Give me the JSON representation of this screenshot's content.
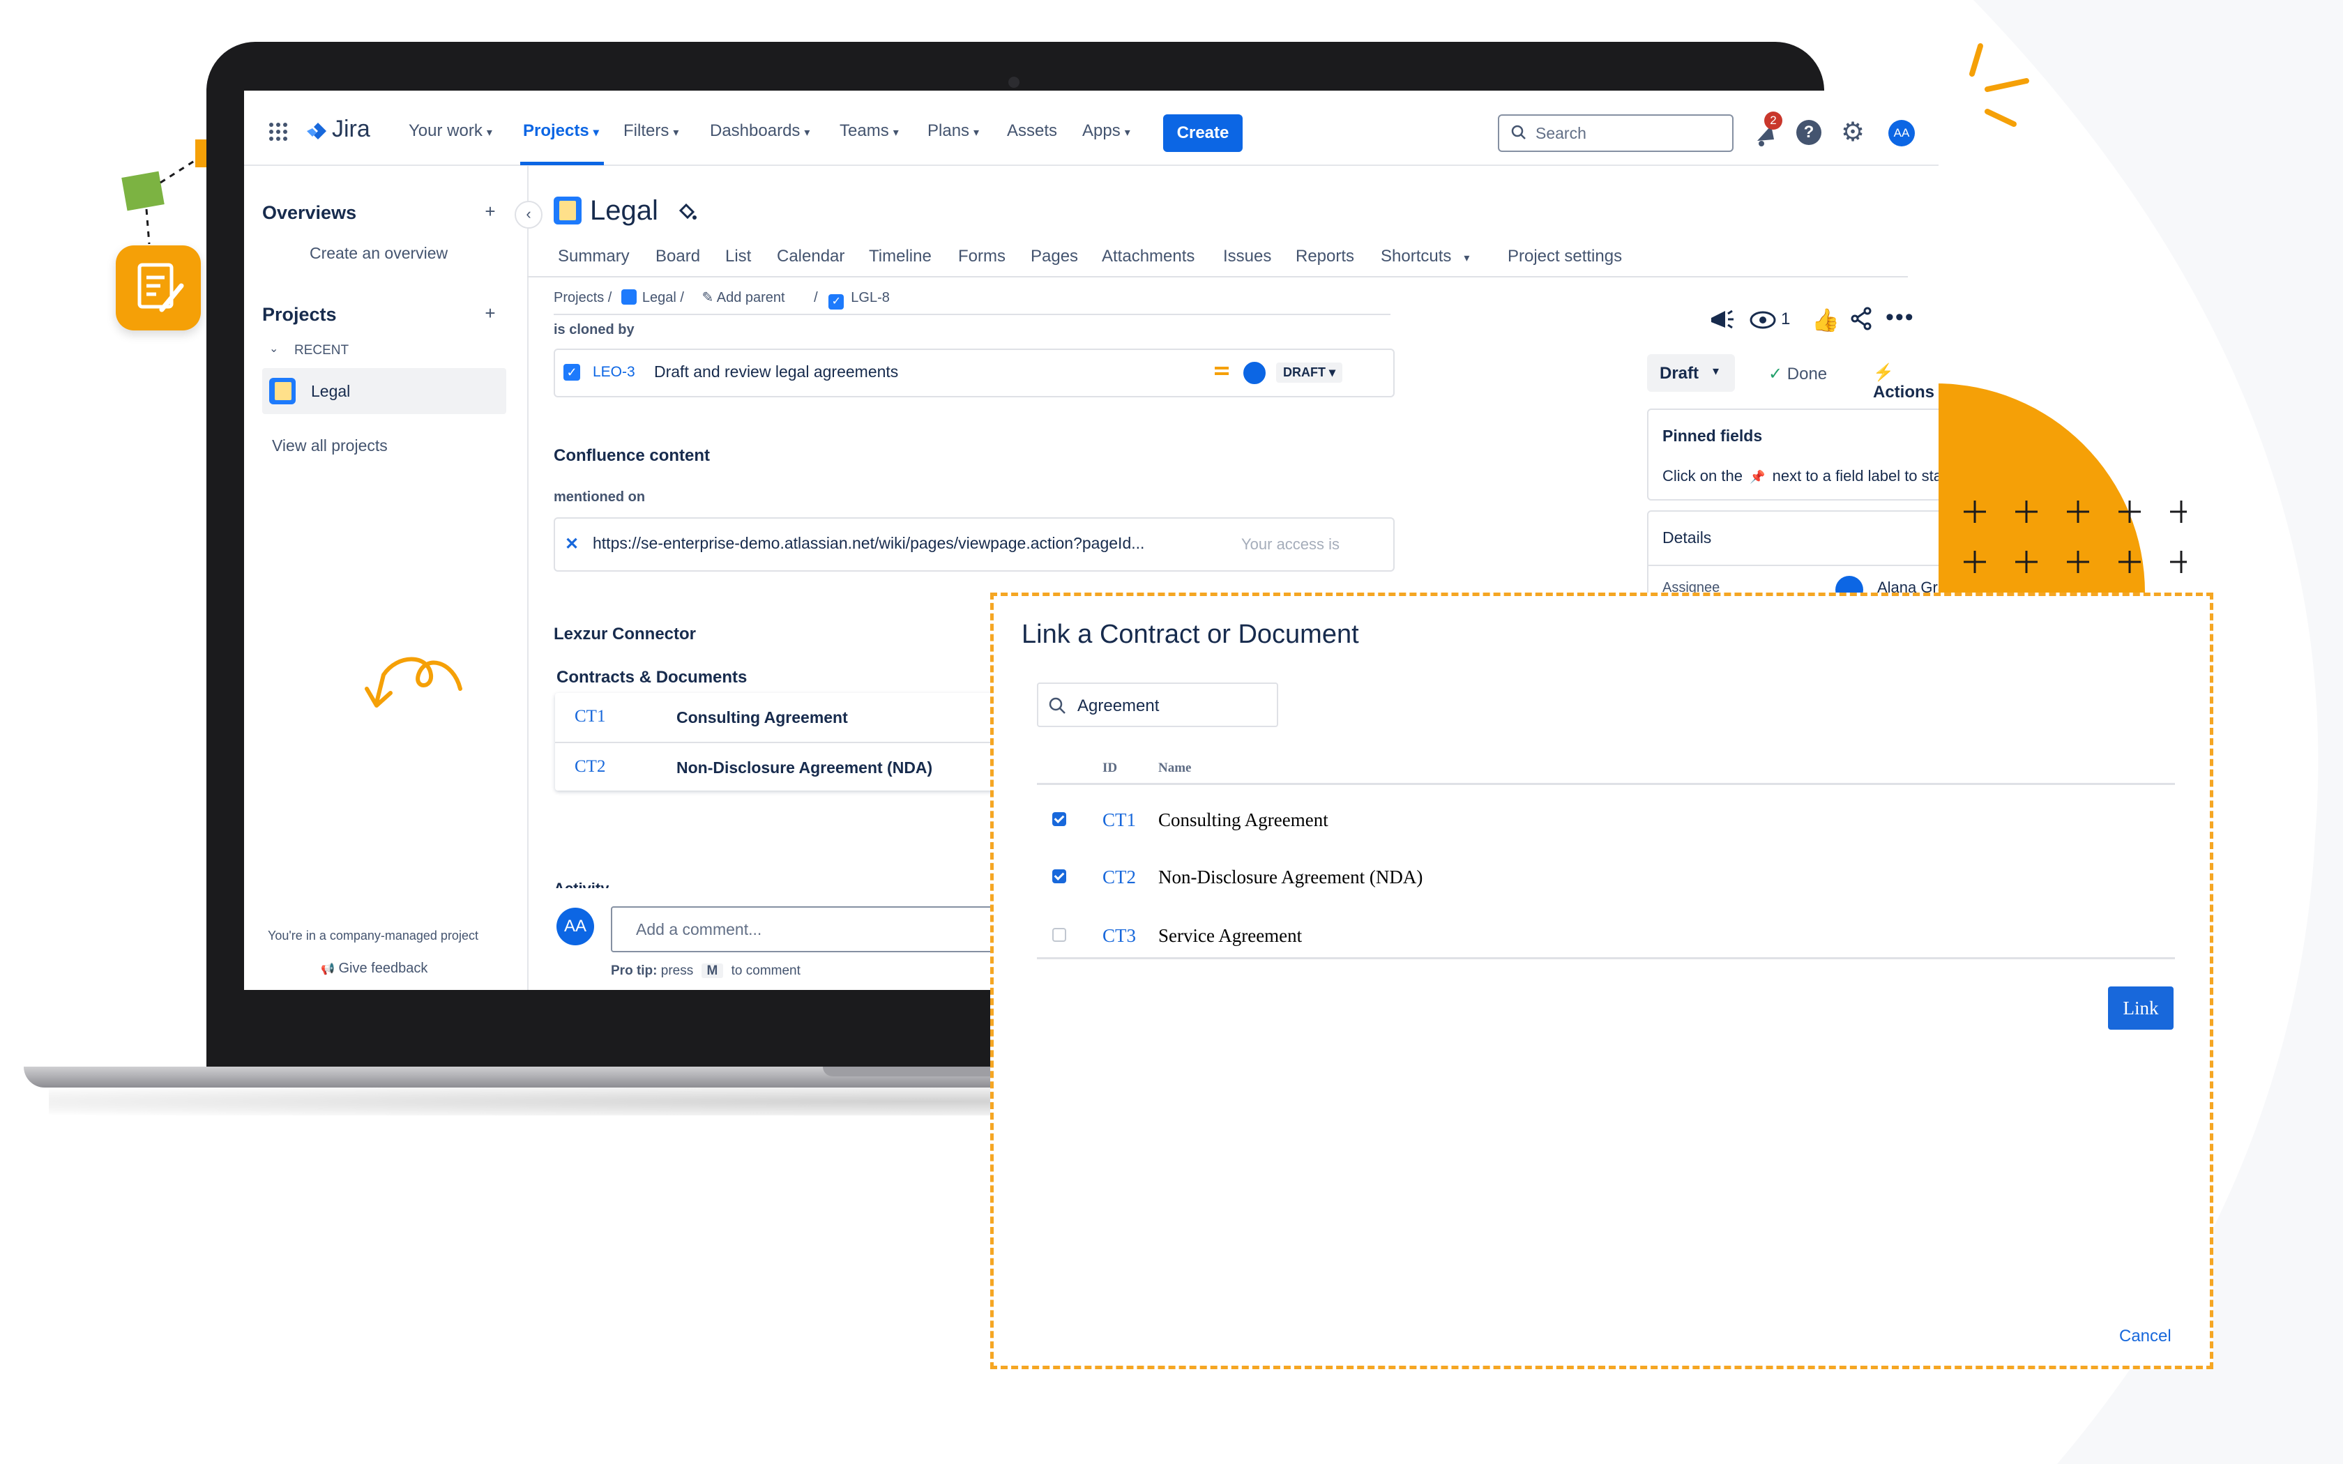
{
  "colors": {
    "accent": "#0c66e4",
    "orange": "#f5a623",
    "ink": "#172b4d",
    "subtle": "#44546f",
    "green_shape": "#7cb342"
  },
  "topnav": {
    "logo_text": "Jira",
    "items": [
      {
        "label": "Your work"
      },
      {
        "label": "Projects"
      },
      {
        "label": "Filters"
      },
      {
        "label": "Dashboards"
      },
      {
        "label": "Teams"
      },
      {
        "label": "Plans"
      },
      {
        "label": "Assets"
      },
      {
        "label": "Apps"
      }
    ],
    "create_label": "Create",
    "search_placeholder": "Search",
    "notification_count": "2",
    "avatar_initials": "AA"
  },
  "sidebar": {
    "overviews_title": "Overviews",
    "create_overview": "Create an overview",
    "projects_title": "Projects",
    "recent_label": "RECENT",
    "recent_project": "Legal",
    "view_all": "View all projects",
    "footer_note": "You're in a company-managed project",
    "feedback": "Give feedback"
  },
  "project": {
    "title": "Legal",
    "tabs": [
      "Summary",
      "Board",
      "List",
      "Calendar",
      "Timeline",
      "Forms",
      "Pages",
      "Attachments",
      "Issues",
      "Reports",
      "Shortcuts",
      "Project settings"
    ]
  },
  "breadcrumb": {
    "projects": "Projects",
    "project": "Legal",
    "add_parent": "Add parent",
    "issue_key": "LGL-8"
  },
  "issue": {
    "cloned_label": "is cloned by",
    "linked_key": "LEO-3",
    "linked_title": "Draft and review legal agreements",
    "linked_status": "DRAFT",
    "confluence_title": "Confluence content",
    "mentioned_on": "mentioned on",
    "confluence_url": "https://se-enterprise-demo.atlassian.net/wiki/pages/viewpage.action?pageId...",
    "access_note": "Your access is",
    "connector_title": "Lexzur Connector",
    "contracts_title": "Contracts & Documents",
    "contracts": [
      {
        "id": "CT1",
        "name": "Consulting Agreement"
      },
      {
        "id": "CT2",
        "name": "Non-Disclosure Agreement (NDA)"
      }
    ],
    "activity_label": "Activity",
    "comment_avatar": "AA",
    "comment_placeholder": "Add a comment...",
    "pro_tip_prefix": "Pro tip:",
    "pro_tip_press": "press",
    "pro_tip_key": "M",
    "pro_tip_suffix": "to comment"
  },
  "right_panel": {
    "watch_count": "1",
    "status_button": "Draft",
    "done_label": "Done",
    "actions_label": "Actions",
    "pinned_title": "Pinned fields",
    "pinned_text_a": "Click on the",
    "pinned_text_b": "next to a field label to start pinning.",
    "details_title": "Details",
    "assignee_label": "Assignee",
    "assignee_name": "Alana Grant"
  },
  "modal": {
    "title": "Link a Contract or Document",
    "search_value": "Agreement",
    "col_id": "ID",
    "col_name": "Name",
    "rows": [
      {
        "id": "CT1",
        "name": "Consulting Agreement",
        "checked": true
      },
      {
        "id": "CT2",
        "name": "Non-Disclosure Agreement (NDA)",
        "checked": true
      },
      {
        "id": "CT3",
        "name": "Service Agreement",
        "checked": false
      }
    ],
    "link_button": "Link",
    "cancel": "Cancel"
  }
}
